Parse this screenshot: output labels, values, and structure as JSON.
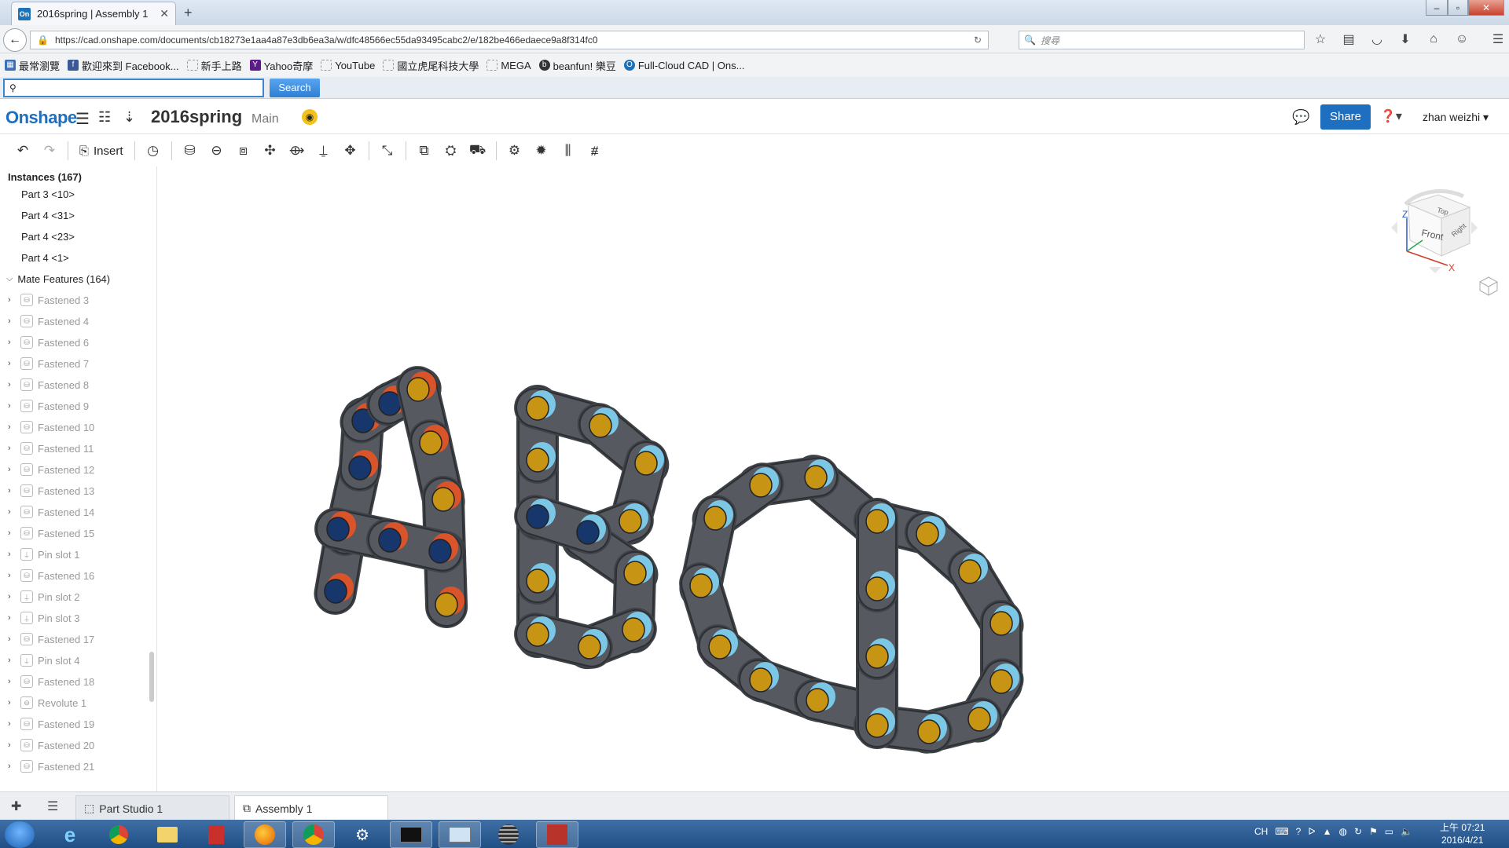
{
  "browser": {
    "tab_title": "2016spring | Assembly 1",
    "tab_icon": "On",
    "url": "https://cad.onshape.com/documents/cb18273e1aa4a87e3db6ea3a/w/dfc48566ec55da93495cabc2/e/182be466edaece9a8f314fc0",
    "search_placeholder": "搜尋",
    "bookmarks": [
      "最常瀏覽",
      "歡迎來到 Facebook...",
      "新手上路",
      "Yahoo奇摩",
      "YouTube",
      "國立虎尾科技大學",
      "MEGA",
      "beanfun! 樂豆",
      "Full-Cloud CAD | Ons..."
    ],
    "find_value": "",
    "find_button": "Search"
  },
  "app": {
    "logo": "Onshape",
    "document_name": "2016spring",
    "branch": "Main",
    "share_label": "Share",
    "user_name": "zhan weizhi",
    "insert_label": "Insert"
  },
  "left_panel": {
    "instances_header": "Instances (167)",
    "parts": [
      "Part 3 <10>",
      "Part 4 <31>",
      "Part 4 <23>",
      "Part 4 <1>"
    ],
    "mate_group": "Mate Features (164)",
    "mates": [
      {
        "label": "Fastened 3",
        "icon": "fastened-icon"
      },
      {
        "label": "Fastened 4",
        "icon": "fastened-icon"
      },
      {
        "label": "Fastened 6",
        "icon": "fastened-icon"
      },
      {
        "label": "Fastened 7",
        "icon": "fastened-icon"
      },
      {
        "label": "Fastened 8",
        "icon": "fastened-icon"
      },
      {
        "label": "Fastened 9",
        "icon": "fastened-icon"
      },
      {
        "label": "Fastened 10",
        "icon": "fastened-icon"
      },
      {
        "label": "Fastened 11",
        "icon": "fastened-icon"
      },
      {
        "label": "Fastened 12",
        "icon": "fastened-icon"
      },
      {
        "label": "Fastened 13",
        "icon": "fastened-icon"
      },
      {
        "label": "Fastened 14",
        "icon": "fastened-icon"
      },
      {
        "label": "Fastened 15",
        "icon": "fastened-icon"
      },
      {
        "label": "Pin slot 1",
        "icon": "pin-slot-icon"
      },
      {
        "label": "Fastened 16",
        "icon": "fastened-icon"
      },
      {
        "label": "Pin slot 2",
        "icon": "pin-slot-icon"
      },
      {
        "label": "Pin slot 3",
        "icon": "pin-slot-icon"
      },
      {
        "label": "Fastened 17",
        "icon": "fastened-icon"
      },
      {
        "label": "Pin slot 4",
        "icon": "pin-slot-icon"
      },
      {
        "label": "Fastened 18",
        "icon": "fastened-icon"
      },
      {
        "label": "Revolute 1",
        "icon": "revolute-icon"
      },
      {
        "label": "Fastened 19",
        "icon": "fastened-icon"
      },
      {
        "label": "Fastened 20",
        "icon": "fastened-icon"
      },
      {
        "label": "Fastened 21",
        "icon": "fastened-icon"
      }
    ]
  },
  "viewcube": {
    "front": "Front",
    "top": "Top",
    "right": "Right",
    "axis_z": "Z",
    "axis_x": "X"
  },
  "bottom_tabs": [
    "Part Studio 1",
    "Assembly 1"
  ],
  "taskbar": {
    "lang": "CH",
    "time": "上午 07:21",
    "date": "2016/4/21"
  },
  "colors": {
    "accent": "#1e6fbf",
    "link_body": "#565a60",
    "pin_gold": "#c79414",
    "pin_blue": "#17366b",
    "roller_orange": "#d9542a",
    "roller_light_blue": "#7cc6e6"
  }
}
